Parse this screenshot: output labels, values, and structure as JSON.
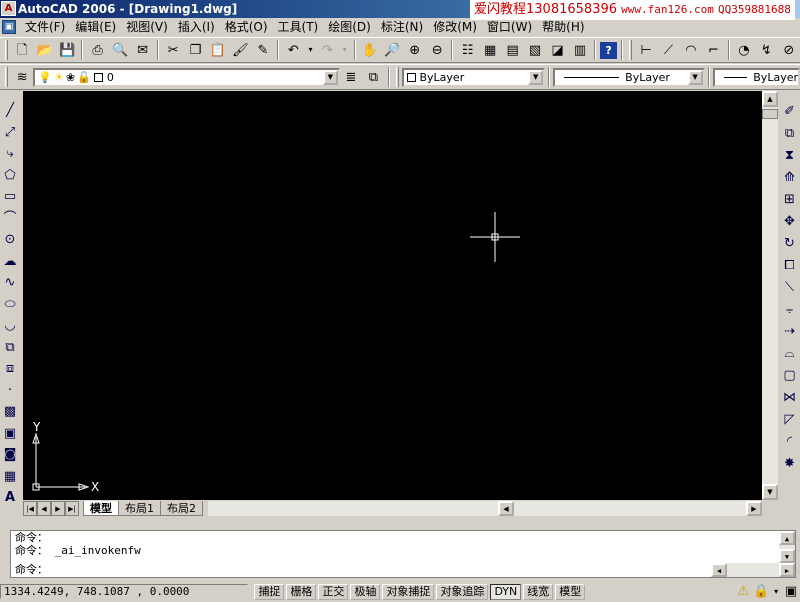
{
  "window": {
    "title": "AutoCAD 2006 - [Drawing1.dwg]"
  },
  "watermark": {
    "name": "爱闪教程",
    "phone": "13081658396",
    "url": "www.fan126.com",
    "qq": "QQ359881688"
  },
  "menu": [
    "文件(F)",
    "编辑(E)",
    "视图(V)",
    "插入(I)",
    "格式(O)",
    "工具(T)",
    "绘图(D)",
    "标注(N)",
    "修改(M)",
    "窗口(W)",
    "帮助(H)"
  ],
  "layer": {
    "current": "0"
  },
  "properties": {
    "color": "ByLayer",
    "linetype": "ByLayer",
    "lineweight": "ByLayer"
  },
  "ucs": {
    "x_label": "X",
    "y_label": "Y"
  },
  "tabs": [
    {
      "label": "模型",
      "active": true
    },
    {
      "label": "布局1"
    },
    {
      "label": "布局2"
    }
  ],
  "command": {
    "lines": [
      "命令：",
      "命令： _ai_invokenfw",
      "命令："
    ]
  },
  "status": {
    "coords": "1334.4249, 748.1087 , 0.0000",
    "buttons": [
      "捕捉",
      "栅格",
      "正交",
      "极轴",
      "对象捕捉",
      "对象追踪",
      "DYN",
      "线宽",
      "模型"
    ]
  },
  "colors": {
    "canvas": "#000000",
    "accent": "#0a246a",
    "watermark": "#cc0000"
  }
}
